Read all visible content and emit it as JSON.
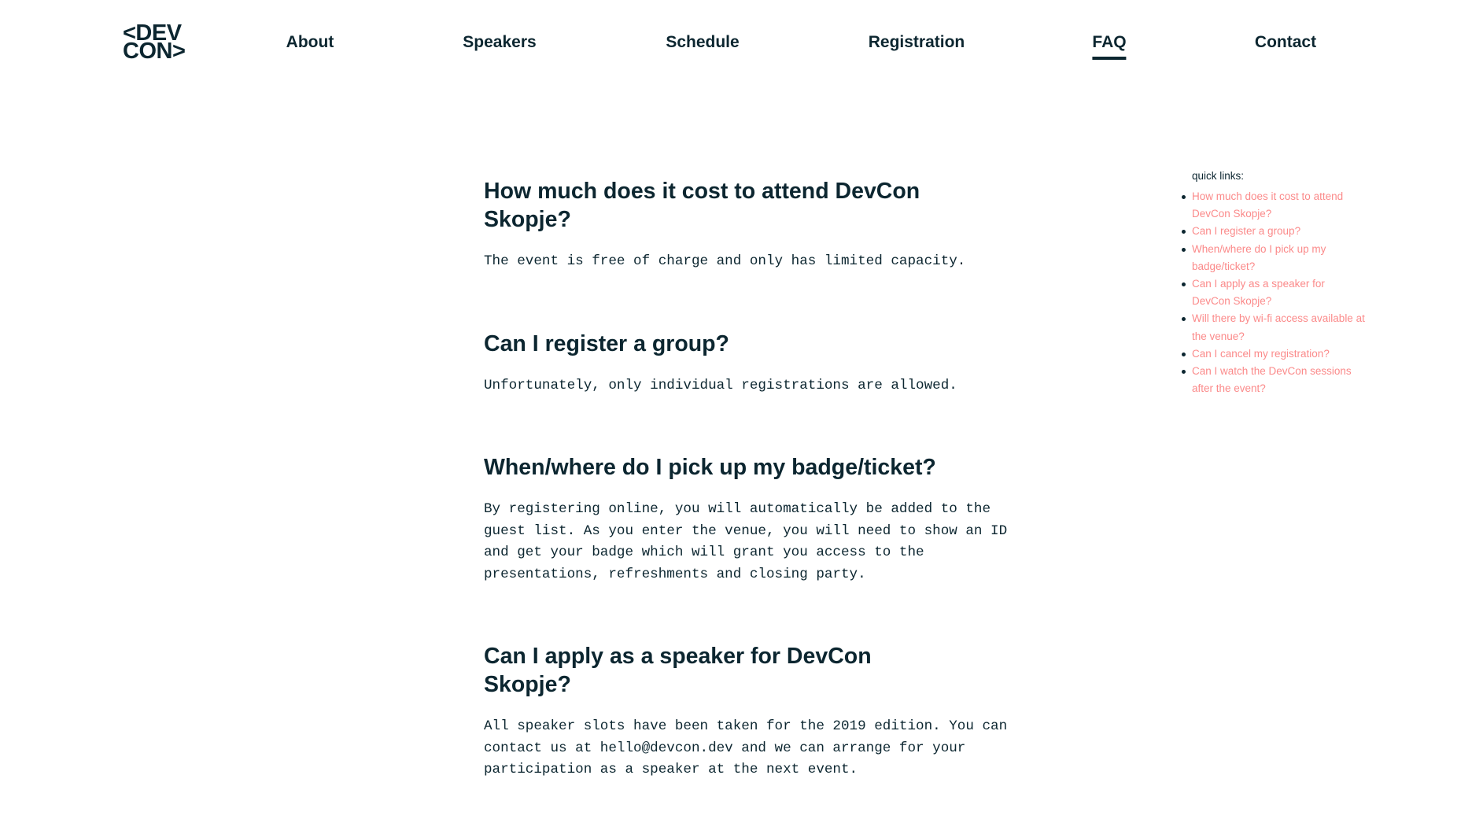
{
  "header": {
    "logo": {
      "line1": "<DEV",
      "line2": "CON>"
    },
    "nav": [
      {
        "label": "About",
        "active": false
      },
      {
        "label": "Speakers",
        "active": false
      },
      {
        "label": "Schedule",
        "active": false
      },
      {
        "label": "Registration",
        "active": false
      },
      {
        "label": "FAQ",
        "active": true
      },
      {
        "label": "Contact",
        "active": false
      }
    ]
  },
  "faq": [
    {
      "question": "How much does it cost to attend DevCon Skopje?",
      "answer": "The event is free of charge and only has limited capacity."
    },
    {
      "question": "Can I register a group?",
      "answer": "Unfortunately, only individual registrations are allowed."
    },
    {
      "question": "When/where do I pick up my badge/ticket?",
      "answer": "By registering online, you will automatically be added to the guest list. As you enter the venue, you will need to show an ID and get your badge which will grant you access to the presentations, refreshments and closing party."
    },
    {
      "question": "Can I apply as a speaker for DevCon Skopje?",
      "answer": "All speaker slots have been taken for the 2019 edition. You can contact us at hello@devcon.dev and we can arrange for your participation as a speaker at the next event."
    }
  ],
  "quick_links": {
    "title": "quick links:",
    "items": [
      "How much does it cost to attend DevCon Skopje?",
      "Can I register a group?",
      "When/where do I pick up my badge/ticket?",
      "Can I apply as a speaker for DevCon Skopje?",
      "Will there by wi-fi access available at the venue?",
      "Can I cancel my registration?",
      "Can I watch the DevCon sessions after the event?"
    ]
  },
  "colors": {
    "text": "#0c2630",
    "link": "#fb8a8a",
    "background": "#ffffff"
  }
}
